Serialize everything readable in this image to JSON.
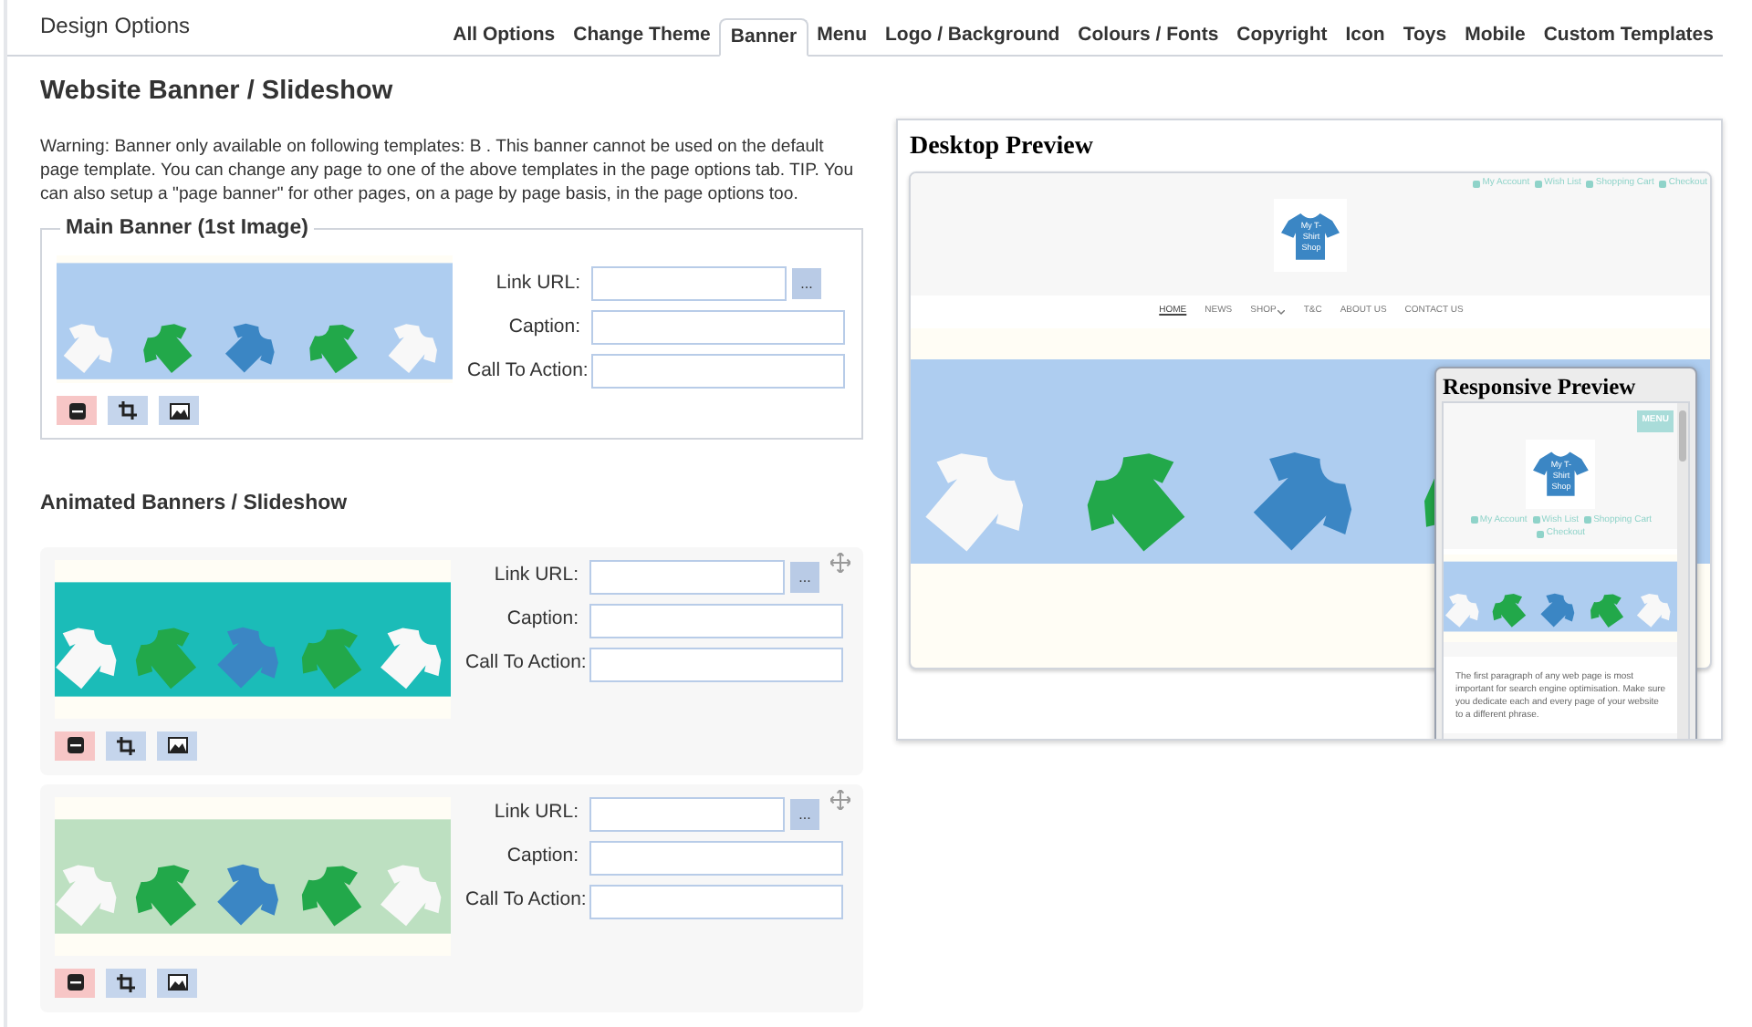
{
  "header": {
    "title": "Design Options"
  },
  "tabs": [
    {
      "label": "All Options",
      "selected": false
    },
    {
      "label": "Change Theme",
      "selected": false
    },
    {
      "label": "Banner",
      "selected": true
    },
    {
      "label": "Menu",
      "selected": false
    },
    {
      "label": "Logo / Background",
      "selected": false
    },
    {
      "label": "Colours / Fonts",
      "selected": false
    },
    {
      "label": "Copyright",
      "selected": false
    },
    {
      "label": "Icon",
      "selected": false
    },
    {
      "label": "Toys",
      "selected": false
    },
    {
      "label": "Mobile",
      "selected": false
    },
    {
      "label": "Custom Templates",
      "selected": false
    }
  ],
  "heading": "Website Banner / Slideshow",
  "warning": "Warning: Banner only available on following templates: B . This banner cannot be used on the default page template. You can change any page to one of the above templates in the page options tab. TIP. You can also setup a \"page banner\" for other pages, on a page by page basis, in the page options too.",
  "main_banner": {
    "legend": "Main Banner (1st Image)",
    "color": "#aecdf0",
    "fields": [
      {
        "label": "Link URL:",
        "button": "..."
      },
      {
        "label": "Caption:"
      },
      {
        "label": "Call To Action:"
      }
    ]
  },
  "animated_heading": "Animated Banners / Slideshow",
  "animated_banners": [
    {
      "color": "#1bbcb8",
      "fields": [
        {
          "label": "Link URL:",
          "button": "..."
        },
        {
          "label": "Caption:"
        },
        {
          "label": "Call To Action:"
        }
      ]
    },
    {
      "color": "#bde0c1",
      "fields": [
        {
          "label": "Link URL:",
          "button": "..."
        },
        {
          "label": "Caption:"
        },
        {
          "label": "Call To Action:"
        }
      ]
    }
  ],
  "desktop_preview": {
    "title": "Desktop Preview",
    "top_links": [
      "My Account",
      "Wish List",
      "Shopping Cart",
      "Checkout"
    ],
    "logo_text": "My T-Shirt Shop",
    "nav": [
      {
        "label": "HOME",
        "selected": true,
        "dropdown": false
      },
      {
        "label": "NEWS",
        "selected": false,
        "dropdown": false
      },
      {
        "label": "SHOP",
        "selected": false,
        "dropdown": true
      },
      {
        "label": "T&C",
        "selected": false,
        "dropdown": false
      },
      {
        "label": "ABOUT US",
        "selected": false,
        "dropdown": false
      },
      {
        "label": "CONTACT US",
        "selected": false,
        "dropdown": false
      }
    ]
  },
  "responsive_preview": {
    "title": "Responsive Preview",
    "menu_button": "MENU",
    "logo_text": "My T-Shirt Shop",
    "links": [
      "My Account",
      "Wish List",
      "Shopping Cart",
      "Checkout"
    ],
    "paragraph": "The first paragraph of any web page is most important for search engine optimisation. Make sure you dedicate each and every page of your website to a different phrase."
  }
}
